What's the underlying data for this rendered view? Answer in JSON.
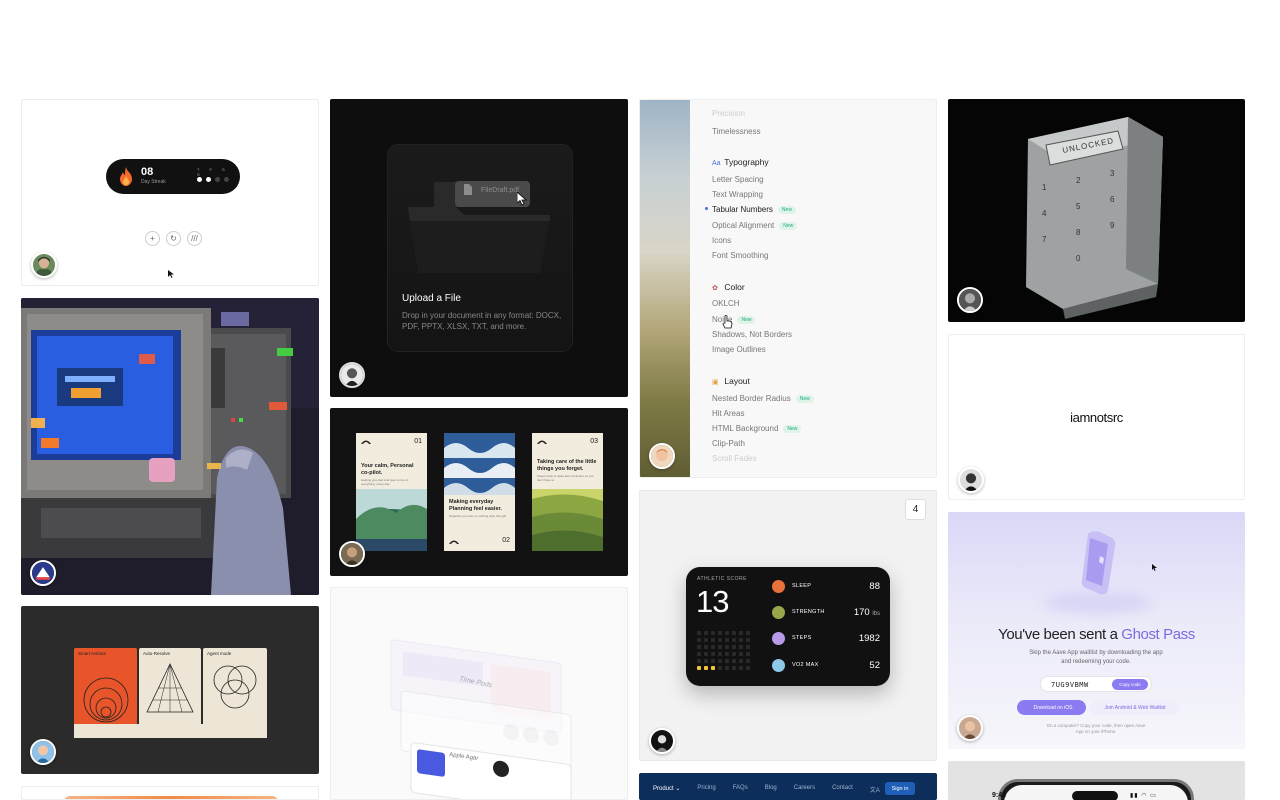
{
  "streak_card": {
    "count": "08",
    "label": "Day Streak",
    "days": "T F S S",
    "controls": [
      "+",
      "↻",
      "///"
    ],
    "avatar_icon": "avatar-photo-icon"
  },
  "upload_card": {
    "file_chip": "FileDraft.pdf",
    "title": "Upload a File",
    "description": "Drop in your document in any format: DOCX, PDF, PPTX, XLSX, TXT, and more."
  },
  "menu_card": {
    "top_faded": "Timelessness",
    "sections": [
      {
        "heading": "Typography",
        "items": [
          "Letter Spacing",
          "Text Wrapping",
          "Tabular Numbers",
          "Optical Alignment",
          "Icons",
          "Font Smoothing"
        ]
      },
      {
        "heading": "Color",
        "items": [
          "OKLCH",
          "Noise",
          "Shadows, Not Borders",
          "Image Outlines"
        ]
      },
      {
        "heading": "Layout",
        "items": [
          "Nested Border Radius",
          "Hit Areas",
          "HTML Background",
          "Clip-Path",
          "Scroll Fades"
        ]
      }
    ],
    "new_tag": "New"
  },
  "unlock_card": {
    "screen_text": "UNLOCKED",
    "keys": [
      "1",
      "2",
      "3",
      "4",
      "5",
      "6",
      "7",
      "8",
      "9",
      "0"
    ]
  },
  "prints_card": {
    "prints": [
      {
        "number": "01",
        "title": "Your calm, Personal co-pilot.",
        "sub": "Helping you plan and stay on top of everything, every day."
      },
      {
        "number": "02",
        "title": "Making everyday Planning feel easier.",
        "sub": "Organize your day so nothing slips through."
      },
      {
        "number": "03",
        "title": "Taking care of the little things you forget.",
        "sub": "Keeps track of tasks and reminders so you don't have to."
      }
    ]
  },
  "iam_card": {
    "wordmark": "iamnotsrc"
  },
  "athletic_card": {
    "count_badge": "4",
    "label": "ATHLETIC SCORE",
    "score": "13",
    "metrics": [
      {
        "name": "SLEEP",
        "value": "88",
        "unit": "",
        "color": "#e8703a"
      },
      {
        "name": "STRENGTH",
        "value": "170",
        "unit": "lbs",
        "color": "#9aa64a"
      },
      {
        "name": "STEPS",
        "value": "1982",
        "unit": "",
        "color": "#b79be8"
      },
      {
        "name": "VO2 MAX",
        "value": "52",
        "unit": "",
        "color": "#8ec9e8"
      }
    ]
  },
  "shapes_card": {
    "panels": [
      "Smart Actions",
      "Auto-Resolve",
      "Agent mode"
    ]
  },
  "wire_card": {
    "card_title": "Time Pods",
    "author": "Apple Agar"
  },
  "ghost_card": {
    "title_prefix": "You've been sent a ",
    "title_highlight": "Ghost Pass",
    "subtitle": "Skip the Aave App waitlist by downloading the app and redeeming your code.",
    "code": "7UG9VBMW",
    "copy_label": "Copy code",
    "ios_label": "Download on iOS",
    "waitlist_label": "Join Android & Web Waitlist",
    "footer": "On a computer? Copy your code, then open Aave App on your iPhone."
  },
  "nav_card": {
    "items": [
      "Product ⌄",
      "Pricing",
      "FAQs",
      "Blog",
      "Careers",
      "Contact",
      "文A"
    ],
    "signin": "Sign in"
  },
  "phone_card": {
    "time": "9:41"
  }
}
